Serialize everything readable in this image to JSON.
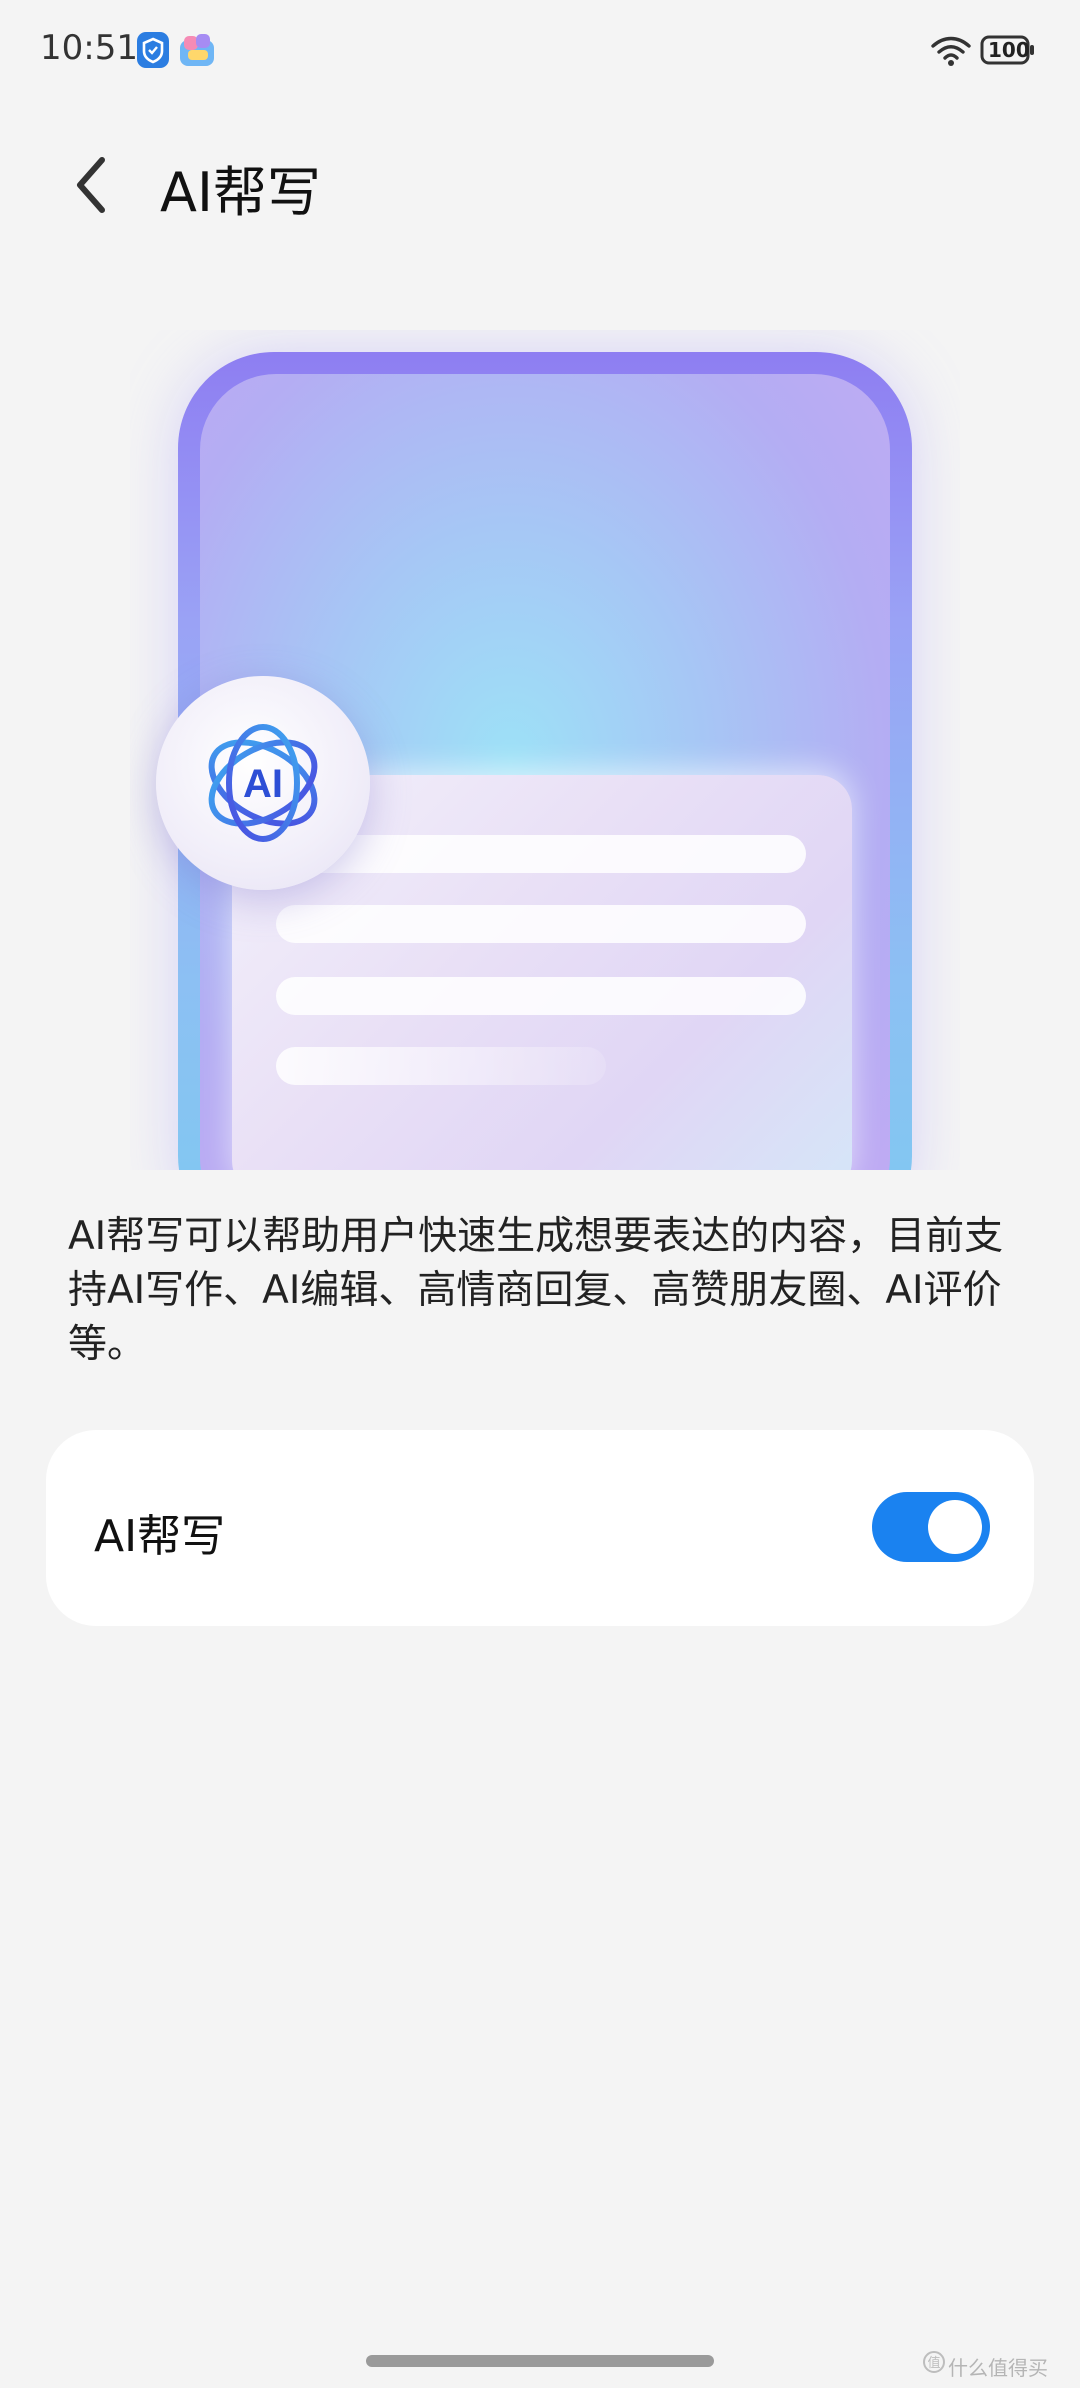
{
  "status_bar": {
    "time": "10:51",
    "battery": "100"
  },
  "header": {
    "title": "AI帮写"
  },
  "hero": {
    "badge_text": "AI"
  },
  "description": "AI帮写可以帮助用户快速生成想要表达的内容，目前支持AI写作、AI编辑、高情商回复、高赞朋友圈、AI评价等。",
  "settings": {
    "ai_write_label": "AI帮写",
    "ai_write_enabled": true
  },
  "watermark": "什么值得买",
  "colors": {
    "background": "#f4f4f4",
    "toggle_on": "#1a82f0",
    "card": "#ffffff"
  }
}
